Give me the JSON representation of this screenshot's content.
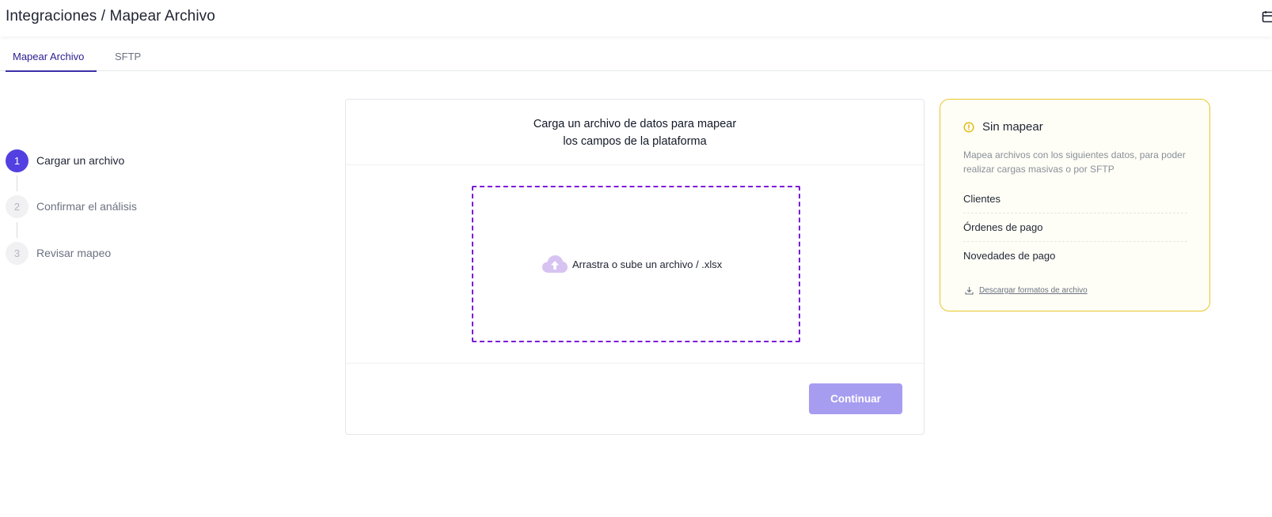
{
  "header": {
    "title": "Integraciones / Mapear Archivo",
    "right_icon": "calendar-icon"
  },
  "tabs": [
    {
      "label": "Mapear Archivo",
      "active": true
    },
    {
      "label": "SFTP",
      "active": false
    }
  ],
  "stepper": {
    "steps": [
      {
        "number": "1",
        "label": "Cargar un archivo",
        "active": true
      },
      {
        "number": "2",
        "label": "Confirmar el análisis",
        "active": false
      },
      {
        "number": "3",
        "label": "Revisar mapeo",
        "active": false
      }
    ]
  },
  "upload_card": {
    "title_line1": "Carga un archivo de datos para mapear",
    "title_line2": "los campos de la plataforma",
    "dropzone_text": "Arrastra o sube un archivo / .xlsx",
    "dropzone_icon": "cloud-upload-icon",
    "continue_label": "Continuar"
  },
  "side_panel": {
    "title": "Sin mapear",
    "description": "Mapea archivos con los siguientes datos, para poder realizar cargas masivas o por SFTP",
    "items": [
      "Clientes",
      "Órdenes de pago",
      "Novedades de pago"
    ],
    "download_label": "Descargar formatos de archivo"
  },
  "colors": {
    "primary": "#5340e0",
    "tab_active": "#2a1d8f",
    "dropzone_border": "#7c1bd9",
    "button_disabled": "#a69df0",
    "panel_border": "#e8c62a",
    "panel_bg": "#fefef6"
  }
}
